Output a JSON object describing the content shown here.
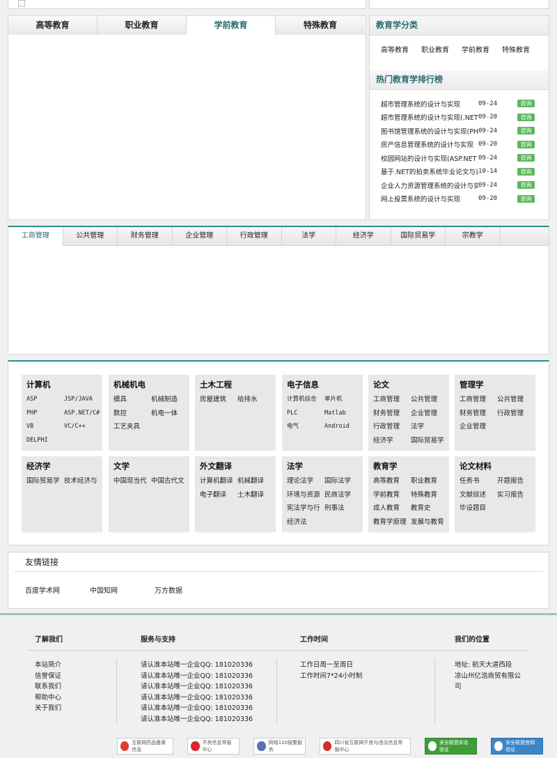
{
  "edu_tabs": [
    "高等教育",
    "职业教育",
    "学前教育",
    "特殊教育"
  ],
  "side": {
    "category_title": "教育学分类",
    "categories": [
      "高等教育",
      "职业教育",
      "学前教育",
      "特殊教育"
    ],
    "rank_title": "热门教育学排行榜",
    "rank_items": [
      {
        "title": "超市管理系统的设计与实现",
        "date": "09-24",
        "btn": "咨询"
      },
      {
        "title": "超市管理系统的设计与实现(.NET",
        "date": "09-20",
        "btn": "咨询"
      },
      {
        "title": "图书馆管理系统的设计与实现(PHP",
        "date": "09-24",
        "btn": "咨询"
      },
      {
        "title": "房产信息管理系统的设计与实现",
        "date": "09-20",
        "btn": "咨询"
      },
      {
        "title": "校园网站的设计与实现(ASP.NET",
        "date": "09-24",
        "btn": "咨询"
      },
      {
        "title": "基于.NET的拍卖系统毕业论文与设",
        "date": "10-14",
        "btn": "咨询"
      },
      {
        "title": "企业人力资源管理系统的设计与实",
        "date": "09-24",
        "btn": "咨询"
      },
      {
        "title": "网上投票系统的设计与实现",
        "date": "09-20",
        "btn": "咨询"
      }
    ]
  },
  "major_tabs": [
    "工商管理",
    "公共管理",
    "财务管理",
    "企业管理",
    "行政管理",
    "法学",
    "经济学",
    "国际贸易学",
    "宗教学"
  ],
  "cat_boxes": [
    {
      "title": "计算机",
      "items": [
        "ASP",
        "JSP/JAVA",
        "PHP",
        "ASP.NET/C#",
        "VB",
        "VC/C++",
        "DELPHI"
      ]
    },
    {
      "title": "机械机电",
      "items": [
        "模具",
        "机械制造",
        "数控",
        "机电一体",
        "工艺夹具"
      ]
    },
    {
      "title": "土木工程",
      "items": [
        "房屋建筑",
        "给排水"
      ]
    },
    {
      "title": "电子信息",
      "items": [
        "计算机综合",
        "单片机",
        "PLC",
        "Matlab",
        "电气",
        "Android"
      ]
    },
    {
      "title": "论文",
      "items": [
        "工商管理",
        "公共管理",
        "财务管理",
        "企业管理",
        "行政管理",
        "法学",
        "经济学",
        "国际贸易学"
      ]
    },
    {
      "title": "管理学",
      "items": [
        "工商管理",
        "公共管理",
        "财务管理",
        "行政管理",
        "企业管理"
      ]
    },
    {
      "title": "经济学",
      "items": [
        "国际贸易学",
        "技术经济与"
      ]
    },
    {
      "title": "文学",
      "items": [
        "中国现当代",
        "中国古代文"
      ]
    },
    {
      "title": "外文翻译",
      "items": [
        "计算机翻译",
        "机械翻译",
        "电子翻译",
        "土木翻译"
      ]
    },
    {
      "title": "法学",
      "items": [
        "理论法学",
        "国际法学",
        "环境与资源",
        "民商法学",
        "宪法学与行",
        "刑事法",
        "经济法"
      ]
    },
    {
      "title": "教育学",
      "items": [
        "高等教育",
        "职业教育",
        "学前教育",
        "特殊教育",
        "成人教育",
        "教育史",
        "教育学原理",
        "发展与教育"
      ]
    },
    {
      "title": "论文材料",
      "items": [
        "任务书",
        "开题报告",
        "文献综述",
        "实习报告",
        "毕设题目"
      ]
    }
  ],
  "friend": {
    "title": "友情链接",
    "links": [
      "百度学术网",
      "中国知网",
      "万方数据"
    ]
  },
  "footer": {
    "col1_title": "了解我们",
    "col1_items": [
      "本站简介",
      "信誉保证",
      "联系我们",
      "帮助中心",
      "关于我们"
    ],
    "col2_title": "服务与支持",
    "col2_items": [
      "请认准本站唯一企业QQ: 181020336",
      "请认准本站唯一企业QQ: 181020336",
      "请认准本站唯一企业QQ: 181020336",
      "请认准本站唯一企业QQ: 181020336",
      "请认准本站唯一企业QQ: 181020336",
      "请认准本站唯一企业QQ: 181020336"
    ],
    "col3_title": "工作时间",
    "col3_items": [
      "工作日周一至周日",
      "工作时间7*24小时制"
    ],
    "col4_title": "我们的位置",
    "col4_items": [
      "地址: 航天大道西段",
      "凉山州亿浩商贸有限公",
      "司"
    ],
    "badges": [
      "互联网药品备案信息",
      "不良信息举报中心",
      "网络110报警服务",
      "四川省互联网不良与违法信息举报中心",
      "安全联盟实名验证",
      "安全联盟官网验证"
    ]
  }
}
